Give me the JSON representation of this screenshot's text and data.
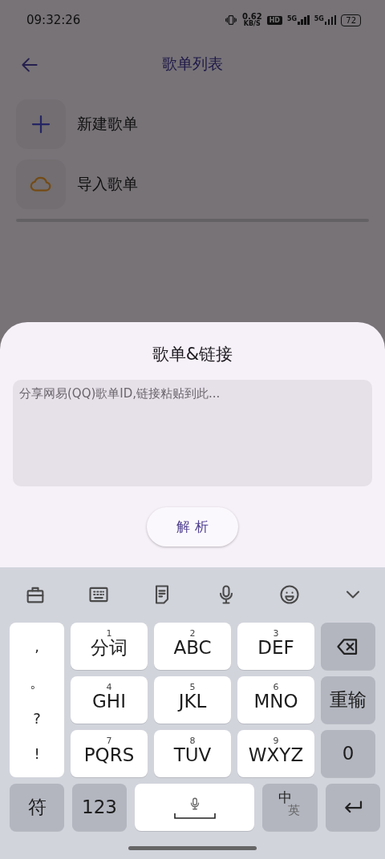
{
  "status_bar": {
    "time": "09:32:26",
    "net_speed": "0.62",
    "net_unit": "KB/S",
    "hd": "HD",
    "signals": [
      "5G",
      "5G"
    ],
    "battery": "72"
  },
  "app_bar": {
    "title": "歌单列表"
  },
  "list": [
    {
      "kind": "add",
      "label": "新建歌单"
    },
    {
      "kind": "cloud",
      "label": "导入歌单"
    }
  ],
  "sheet": {
    "title": "歌单&链接",
    "placeholder": "分享网易(QQ)歌单ID,链接粘贴到此...",
    "button": "解 析"
  },
  "keyboard": {
    "punctuation": [
      ",",
      "。",
      "?",
      "!"
    ],
    "keys": [
      {
        "number": "1",
        "label": "分词"
      },
      {
        "number": "2",
        "label": "ABC"
      },
      {
        "number": "3",
        "label": "DEF"
      },
      {
        "number": "4",
        "label": "GHI"
      },
      {
        "number": "5",
        "label": "JKL"
      },
      {
        "number": "6",
        "label": "MNO"
      },
      {
        "number": "7",
        "label": "PQRS"
      },
      {
        "number": "8",
        "label": "TUV"
      },
      {
        "number": "9",
        "label": "WXYZ"
      }
    ],
    "side_keys": [
      {
        "kind": "backspace"
      },
      {
        "kind": "text",
        "label": "重输"
      },
      {
        "kind": "text",
        "label": "0"
      }
    ],
    "bottom_keys": [
      {
        "kind": "text",
        "label": "符"
      },
      {
        "kind": "text",
        "label": "123"
      },
      {
        "kind": "space"
      },
      {
        "kind": "lang",
        "label": "中",
        "sub": "英"
      },
      {
        "kind": "enter"
      }
    ]
  }
}
